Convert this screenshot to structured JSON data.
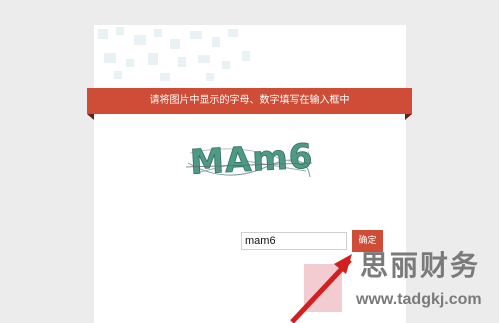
{
  "banner": {
    "text": "请将图片中显示的字母、数字填写在输入框中"
  },
  "captcha": {
    "text": "MAm6",
    "color": "#4e9a84"
  },
  "form": {
    "input_value": "mam6",
    "confirm_label": "确定"
  },
  "watermark": {
    "brand": "思丽财务",
    "url": "www.tadgkj.com"
  },
  "colors": {
    "accent": "#cf4c37",
    "page_bg": "#ececec"
  }
}
